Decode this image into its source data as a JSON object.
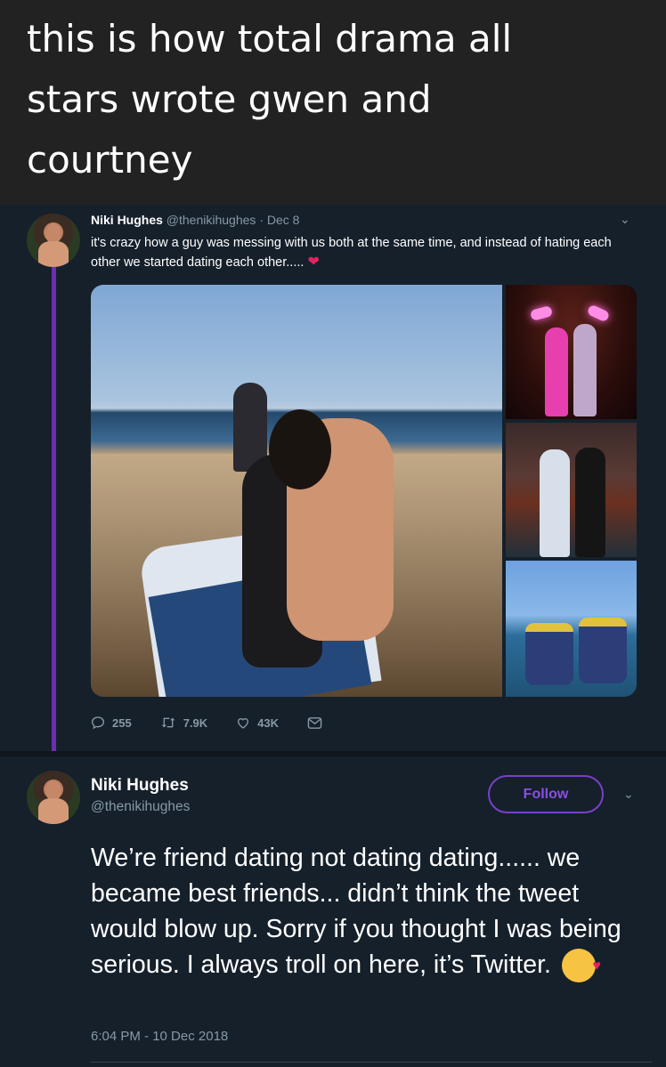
{
  "caption": {
    "line1": "this is how total drama all",
    "line2": "stars wrote gwen and",
    "line3": "courtney"
  },
  "tweet1": {
    "name": "Niki Hughes",
    "handle": "@thenikihughes",
    "separator": "·",
    "date": "Dec 8",
    "text": "it's crazy how a guy was messing with us both at the same time, and instead of hating each other we started dating each other.....",
    "replies": "255",
    "retweets": "7.9K",
    "likes": "43K",
    "accent_color": "#6a2fb0"
  },
  "tweet2": {
    "name": "Niki Hughes",
    "handle": "@thenikihughes",
    "follow_label": "Follow",
    "text": "We’re friend dating not dating dating...... we became best friends... didn’t think the tweet would blow up. Sorry if you thought I was being serious. I always troll on here, it’s Twitter.",
    "timestamp": "6:04 PM - 10 Dec 2018",
    "follow_color": "#7a3fc7"
  },
  "icons": {
    "reply": "reply-icon",
    "retweet": "retweet-icon",
    "like": "heart-icon",
    "dm": "envelope-icon",
    "caret": "chevron-down-icon",
    "emoji": "kissing-face-emoji"
  }
}
